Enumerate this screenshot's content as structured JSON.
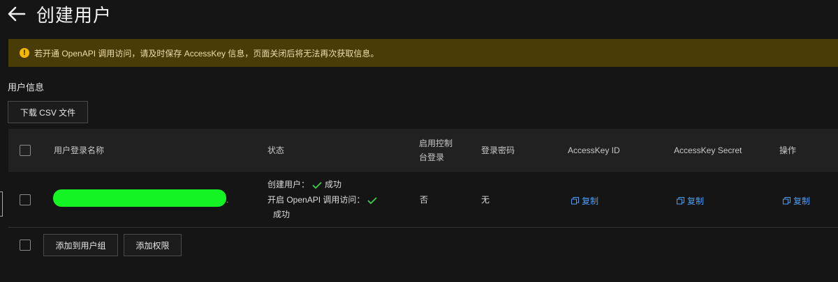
{
  "header": {
    "title": "创建用户"
  },
  "alert": {
    "text": "若开通 OpenAPI 调用访问，请及时保存 AccessKey 信息，页面关闭后将无法再次获取信息。"
  },
  "section": {
    "title": "用户信息"
  },
  "actions": {
    "download_csv": "下载 CSV 文件"
  },
  "table": {
    "columns": [
      "用户登录名称",
      "状态",
      "启用控制台登录",
      "登录密码",
      "AccessKey ID",
      "AccessKey Secret",
      "操作"
    ],
    "rows": [
      {
        "username_suffix": ".",
        "status_create_label": "创建用户：",
        "status_create_result": "成功",
        "status_openapi_label": "开启 OpenAPI 调用访问：",
        "status_openapi_result": "成功",
        "console_login": "否",
        "password": "无",
        "accesskey_id_action": "复制",
        "accesskey_secret_action": "复制",
        "operation_action": "复制"
      }
    ]
  },
  "footer": {
    "add_to_group": "添加到用户组",
    "add_permission": "添加权限"
  },
  "colors": {
    "accent": "#4d9ef5",
    "success": "#3ccf4e",
    "warning_bg": "#4a3c06",
    "warning_icon": "#f5b800"
  }
}
